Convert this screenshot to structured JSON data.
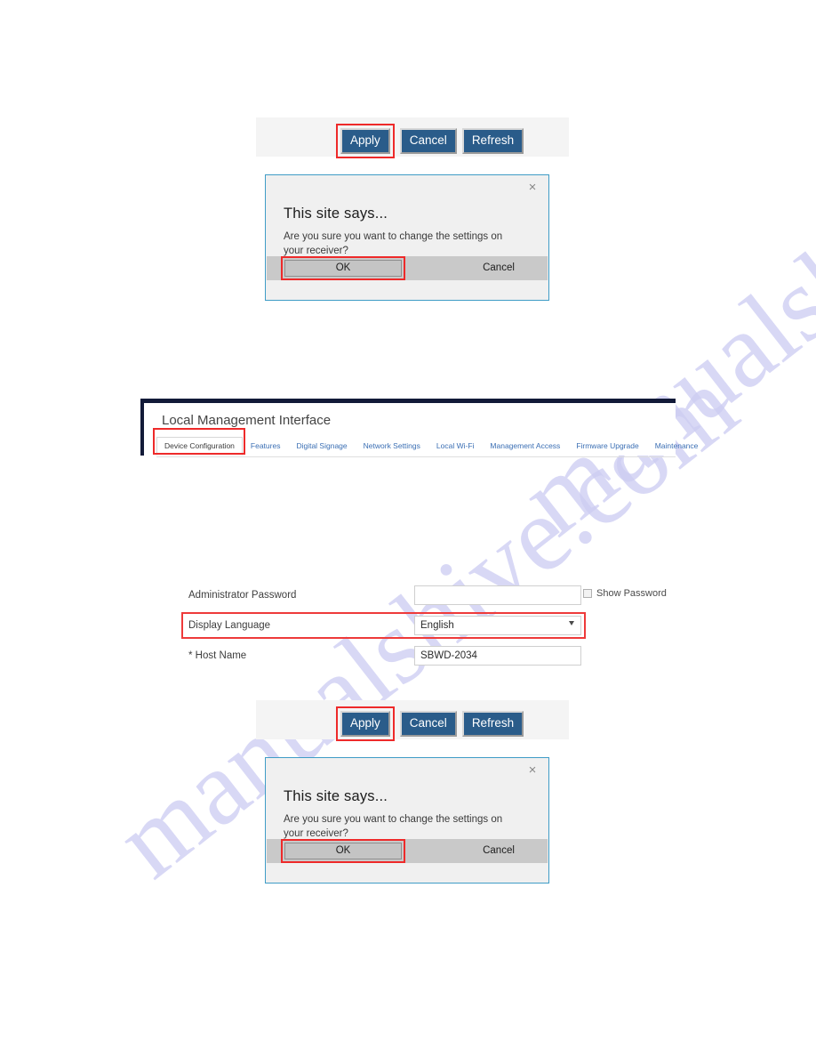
{
  "watermark": {
    "text": "manualshive.com"
  },
  "button_row": {
    "apply_label": "Apply",
    "cancel_label": "Cancel",
    "refresh_label": "Refresh"
  },
  "dialog": {
    "title": "This site says...",
    "message": "Are you sure you want to change the settings on your receiver?",
    "ok_label": "OK",
    "cancel_label": "Cancel",
    "close_icon": "×"
  },
  "panel": {
    "title": "Local Management Interface",
    "tabs": [
      {
        "label": "Device Configuration",
        "active": true
      },
      {
        "label": "Features",
        "active": false
      },
      {
        "label": "Digital Signage",
        "active": false
      },
      {
        "label": "Network Settings",
        "active": false
      },
      {
        "label": "Local Wi-Fi",
        "active": false
      },
      {
        "label": "Management Access",
        "active": false
      },
      {
        "label": "Firmware Upgrade",
        "active": false
      },
      {
        "label": "Maintenance",
        "active": false
      }
    ]
  },
  "form": {
    "admin_password": {
      "label": "Administrator Password",
      "value": "",
      "show_password_label": "Show Password",
      "show_password_checked": false
    },
    "display_language": {
      "label": "Display Language",
      "value": "English",
      "highlighted": true
    },
    "host_name": {
      "label": "* Host Name",
      "value": "SBWD-2034"
    }
  },
  "colors": {
    "button_blue": "#2a5c8a",
    "highlight_red": "#ee2a2a",
    "dialog_border": "#3f9cc6",
    "panel_bar": "#121a38",
    "tab_link": "#3b6fb4",
    "watermark": "#ccccf2"
  }
}
